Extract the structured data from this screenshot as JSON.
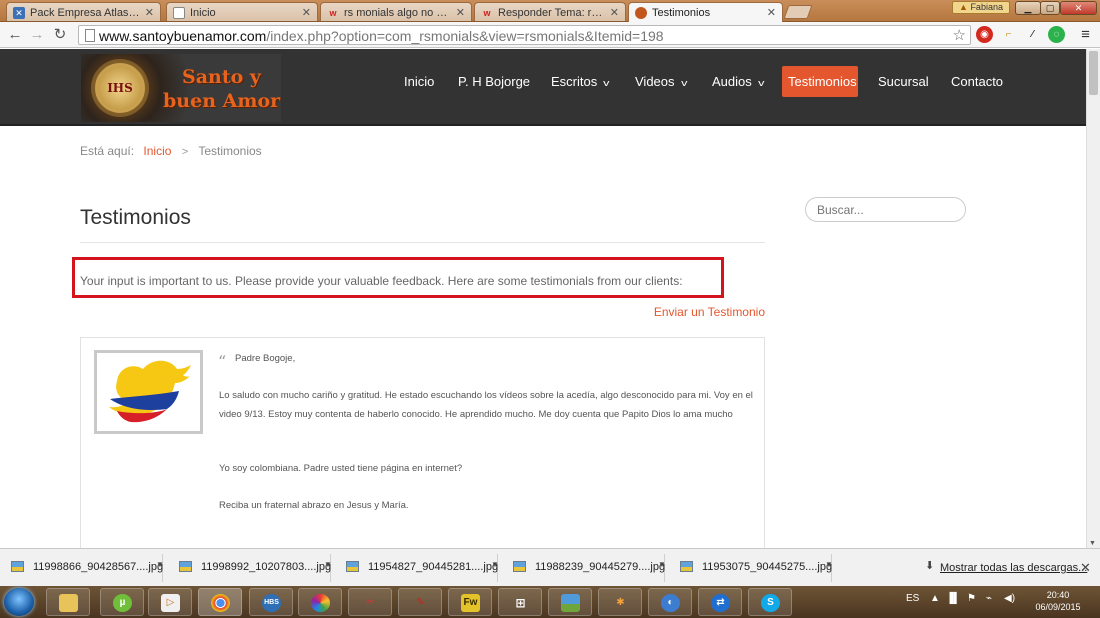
{
  "browser": {
    "tabs": [
      {
        "title": "Pack Empresa Atlas - Adm",
        "icon": "joomla-icon",
        "color": "#3b6fb6"
      },
      {
        "title": "Inicio",
        "icon": "page-icon",
        "color": "#888888"
      },
      {
        "title": "rs monials algo no se trad",
        "icon": "w-logo-icon",
        "color": "#cc2020"
      },
      {
        "title": "Responder Tema: rs monia",
        "icon": "w-logo-icon",
        "color": "#cc2020"
      },
      {
        "title": "Testimonios",
        "icon": "site-favicon",
        "color": "#c2571e"
      }
    ],
    "user_name": "Fabiana",
    "url_host": "www.santoybuenamor.com",
    "url_path": "/index.php?option=com_rsmonials&view=rsmonials&Itemid=198"
  },
  "site": {
    "logo_text_line1": "Santo y",
    "logo_text_line2": "buen Amor",
    "logo_seal_text": "IHS",
    "menu": [
      {
        "label": "Inicio",
        "dropdown": false,
        "active": false
      },
      {
        "label": "P. H Bojorge",
        "dropdown": false,
        "active": false
      },
      {
        "label": "Escritos",
        "dropdown": true,
        "active": false
      },
      {
        "label": "Videos",
        "dropdown": true,
        "active": false
      },
      {
        "label": "Audios",
        "dropdown": true,
        "active": false
      },
      {
        "label": "Testimonios",
        "dropdown": false,
        "active": true
      },
      {
        "label": "Sucursal",
        "dropdown": false,
        "active": false
      },
      {
        "label": "Contacto",
        "dropdown": false,
        "active": false
      }
    ],
    "accent_color": "#e4572e"
  },
  "breadcrumb": {
    "prefix": "Está aquí:",
    "home": "Inicio",
    "current": "Testimonios"
  },
  "page": {
    "title": "Testimonios",
    "intro": "Your input is important to us. Please provide your valuable feedback. Here are some testimonials from our clients:",
    "send_link": "Enviar un Testimonio"
  },
  "testimonial": {
    "greeting": "Padre Bogoje,",
    "paragraphs": [
      "Lo saludo con mucho cariño y gratitud. He estado escuchando los vídeos sobre la acedía, algo desconocido para mi. Voy en el video 9/13. Estoy muy contenta de haberlo conocido. He aprendido mucho. Me doy cuenta que Papito Dios lo ama mucho",
      "Yo soy colombiana. Padre usted tiene página en internet?",
      "Reciba un fraternal abrazo en Jesus y María."
    ]
  },
  "sidebar": {
    "search_placeholder": "Buscar..."
  },
  "downloads": {
    "items": [
      "11998866_90428567....jpg",
      "11998992_10207803....jpg",
      "11954827_90445281....jpg",
      "11988239_90445279....jpg",
      "11953075_90445275....jpg"
    ],
    "show_all": "Mostrar todas las descargas..."
  },
  "taskbar": {
    "apps": [
      "explorer-icon",
      "utorrent-icon",
      "media-player-icon",
      "chrome-icon",
      "hbs-icon",
      "picasa-icon",
      "tools-icon",
      "writer-icon",
      "fireworks-icon",
      "apps-grid-icon",
      "photo-viewer-icon",
      "game-icon",
      "media-center-icon",
      "teamviewer-icon",
      "skype-icon"
    ],
    "fireworks_label": "Fw",
    "hbs_label": "HBS",
    "language": "ES",
    "time": "20:40",
    "date": "06/09/2015"
  }
}
